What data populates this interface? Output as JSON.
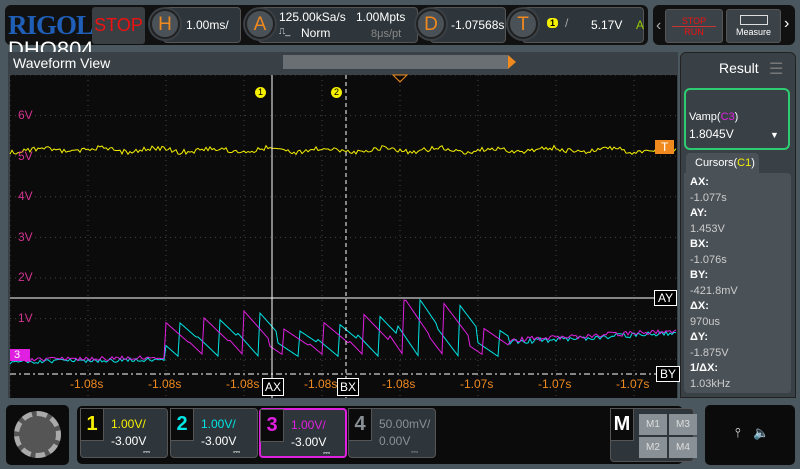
{
  "header": {
    "brand": "RIGOL",
    "model": "DHO804",
    "run_state": "STOP",
    "horizontal": {
      "key": "H",
      "scale": "1.00ms/"
    },
    "acquire": {
      "key": "A",
      "sample_rate": "125.00kSa/s",
      "mode": "Norm",
      "depth": "1.00Mpts",
      "interval": "8μs/pt"
    },
    "delay": {
      "key": "D",
      "value": "-1.07568s"
    },
    "trigger": {
      "key": "T",
      "source": "1",
      "level": "5.17V",
      "status": "A"
    },
    "stop_run": {
      "stop": "STOP",
      "run": "RUN"
    },
    "measure": "Measure"
  },
  "waveform": {
    "title": "Waveform View",
    "y_labels": [
      "6V",
      "5V",
      "4V",
      "3V",
      "2V",
      "1V"
    ],
    "x_labels": [
      "-1.08s",
      "-1.08s",
      "-1.08s",
      "-1.08s",
      "-1.08s",
      "-1.07s",
      "-1.07s",
      "-1.07s"
    ],
    "cursor_markers": {
      "ax": "AX",
      "bx": "BX",
      "ay": "AY",
      "by": "BY",
      "c1": "1",
      "c2": "2"
    },
    "trigger_marker": "T",
    "ch3_marker": "3",
    "colors": {
      "ch1": "#f5f000",
      "ch2": "#00e5e5",
      "ch3": "#e020e0",
      "axis": "#f08a1e"
    }
  },
  "result": {
    "title": "Result",
    "measure_label": "Vamp(",
    "measure_src": "C3",
    "measure_value": "1.8045V",
    "cursors_label": "Cursors(",
    "cursors_src": "C1",
    "cursors": [
      {
        "k": "AX:",
        "v": "-1.077s"
      },
      {
        "k": "AY:",
        "v": "1.453V"
      },
      {
        "k": "BX:",
        "v": "-1.076s"
      },
      {
        "k": "BY:",
        "v": "-421.8mV"
      },
      {
        "k": "ΔX:",
        "v": "970us"
      },
      {
        "k": "ΔY:",
        "v": "-1.875V"
      },
      {
        "k": "1/ΔX:",
        "v": "1.03kHz"
      }
    ]
  },
  "channels": [
    {
      "n": "1",
      "scale": "1.00V/",
      "offset": "-3.00V",
      "color": "#f5f000"
    },
    {
      "n": "2",
      "scale": "1.00V/",
      "offset": "-3.00V",
      "color": "#00e5e5"
    },
    {
      "n": "3",
      "scale": "1.00V/",
      "offset": "-3.00V",
      "color": "#e020e0"
    },
    {
      "n": "4",
      "scale": "50.00mV/",
      "offset": "0.00V",
      "color": "#8a9196"
    }
  ],
  "math": {
    "label": "M",
    "items": [
      "M1",
      "M3",
      "M2",
      "M4"
    ]
  }
}
